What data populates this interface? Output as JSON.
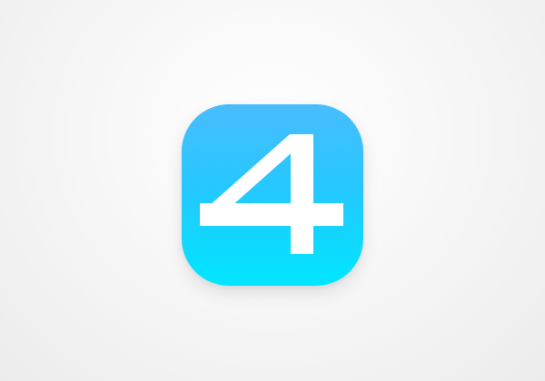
{
  "app_icon": {
    "glyph": "4",
    "icon": "four-icon",
    "colors": {
      "gradient_top": "#39b7ff",
      "gradient_bottom": "#00e6ff",
      "glyph": "#ffffff",
      "background": "#f7f7f7"
    }
  }
}
